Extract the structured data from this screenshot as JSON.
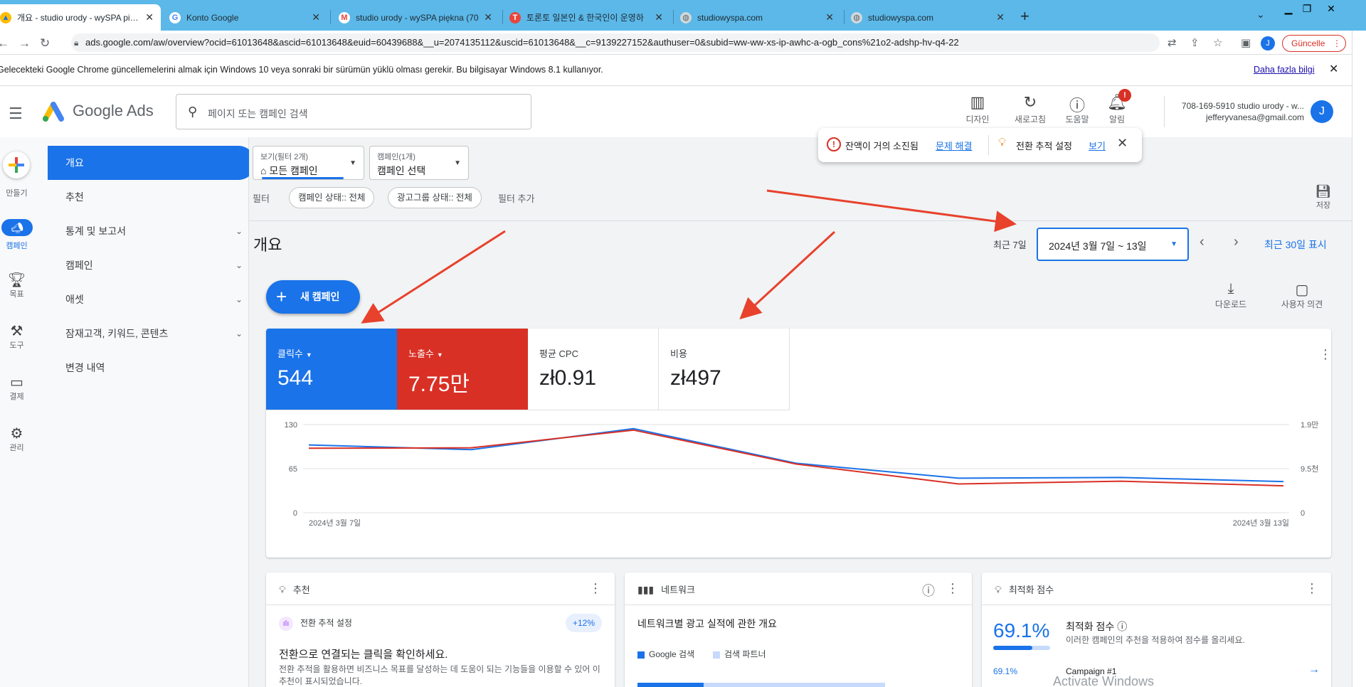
{
  "browser": {
    "tabs": [
      {
        "title": "개요 - studio urody - wySPA piękna",
        "active": true
      },
      {
        "title": "Konto Google"
      },
      {
        "title": "studio urody - wySPA piękna (70"
      },
      {
        "title": "토론토 일본인 & 한국인이 운영하"
      },
      {
        "title": "studiowyspa.com"
      },
      {
        "title": "studiowyspa.com"
      }
    ],
    "new_tab": "+",
    "url": "ads.google.com/aw/overview?ocid=61013648&ascid=61013648&euid=60439688&__u=2074135112&uscid=61013648&__c=9139227152&authuser=0&subid=ww-ww-xs-ip-awhc-a-ogb_cons%21o2-adshp-hv-q4-22",
    "profile_initial": "J",
    "update_label": "Güncelle",
    "infobar_message": "Gelecekteki Google Chrome güncellemelerini almak için Windows 10 veya sonraki bir sürümün yüklü olması gerekir. Bu bilgisayar Windows 8.1 kullanıyor.",
    "infobar_link": "Daha fazla bilgi"
  },
  "header": {
    "product": "Google Ads",
    "search_placeholder": "페이지 또는 캠페인 검색",
    "tools": [
      "디자인",
      "새로고침",
      "도움말",
      "알림"
    ],
    "notif_count": "!",
    "account_line1": "708-169-5910 studio urody - w...",
    "account_line2": "jefferyvanesa@gmail.com",
    "avatar_initial": "J"
  },
  "rail": {
    "items": [
      "만들기",
      "캠페인",
      "목표",
      "도구",
      "결제",
      "관리"
    ]
  },
  "nav": {
    "items": [
      "개요",
      "추천",
      "통계 및 보고서",
      "캠페인",
      "애셋",
      "잠재고객, 키워드, 콘텐츠",
      "변경 내역"
    ]
  },
  "filters": {
    "view_caption": "보기(필터 2개)",
    "view_value": "모든 캠페인",
    "campaign_caption": "캠페인(1개)",
    "campaign_value": "캠페인 선택",
    "filter_label": "필터",
    "chips": [
      "캠페인 상태:: 전체",
      "광고그룹 상태:: 전체"
    ],
    "add_filter": "필터 추가",
    "save": "저장"
  },
  "overview": {
    "title": "개요",
    "range_label": "최근 7일",
    "date_range": "2024년 3월 7일 ~ 13일",
    "show_30": "최근 30일 표시",
    "new_campaign": "새 캠페인",
    "download": "다운로드",
    "feedback": "사용자 의견"
  },
  "metrics": [
    {
      "label": "클릭수",
      "value": "544"
    },
    {
      "label": "노출수",
      "value": "7.75만"
    },
    {
      "label": "평균 CPC",
      "value": "zł0.91"
    },
    {
      "label": "비용",
      "value": "zł497"
    }
  ],
  "chart_data": {
    "type": "line",
    "x": [
      "2024-03-07",
      "2024-03-08",
      "2024-03-09",
      "2024-03-10",
      "2024-03-11",
      "2024-03-12",
      "2024-03-13"
    ],
    "x_tick_labels": [
      "2024년 3월 7일",
      "2024년 3월 13일"
    ],
    "y_left_ticks": [
      "130",
      "65",
      "0"
    ],
    "y_right_ticks": [
      "1.9만",
      "9.5천",
      "0"
    ],
    "ylim_left": [
      0,
      130
    ],
    "ylim_right": [
      0,
      19000
    ],
    "series": [
      {
        "name": "클릭수",
        "axis": "left",
        "color": "#1a73e8",
        "values": [
          100,
          93,
          124,
          73,
          51,
          52,
          46
        ]
      },
      {
        "name": "노출수",
        "axis": "right",
        "color": "#d93025",
        "values": [
          13900,
          14000,
          17800,
          10500,
          6200,
          6800,
          5800
        ]
      }
    ],
    "grid": true
  },
  "cards": {
    "rec": {
      "title": "추천",
      "sub": "전환 추적 설정",
      "badge": "+12%",
      "head": "전환으로 연결되는 클릭을 확인하세요.",
      "body": "전환 추적을 활용하면 비즈니스 목표를 달성하는 데 도움이 되는 기능들을 이용할 수 있어 이 추천이 표시되었습니다."
    },
    "net": {
      "title": "네트워크",
      "subtitle": "네트워크별 광고 실적에 관한 개요",
      "legend": [
        "Google 검색",
        "검색 파트너"
      ],
      "share_google": 0.27
    },
    "opt": {
      "title": "최적화 점수",
      "score": "69.1%",
      "score_fraction": 0.691,
      "heading": "최적화 점수",
      "desc": "이러한 캠페인의 추천을 적용하여 점수를 올리세요.",
      "row_score": "69.1%",
      "row_name": "Campaign #1"
    }
  },
  "toast": {
    "msg1": "잔액이 거의 소진됨",
    "link1": "문제 해결",
    "msg2": "전환 추적 설정",
    "link2": "보기"
  },
  "watermark": "Activate Windows"
}
